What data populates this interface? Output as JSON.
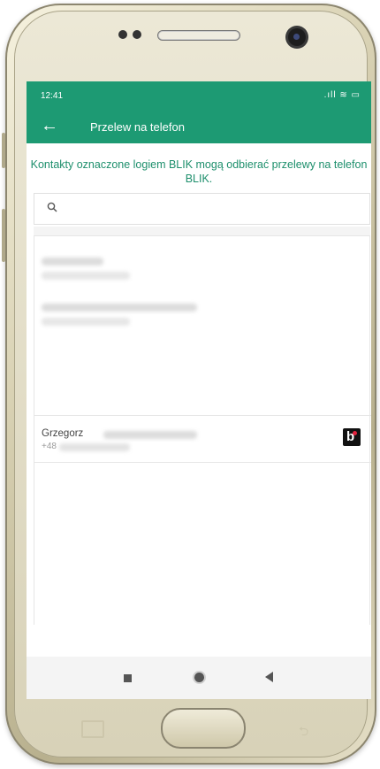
{
  "status_bar": {
    "time": "12:41",
    "icons": ".ıll ≋ ▭"
  },
  "app_bar": {
    "back_icon": "←",
    "title": "Przelew na telefon"
  },
  "info": {
    "text": "Kontakty oznaczone logiem BLIK mogą odbierać przelewy na telefon BLIK."
  },
  "search": {
    "placeholder": "",
    "value": ""
  },
  "contacts": [
    {
      "name": "Grzegorz",
      "phone": "+48",
      "blik": true,
      "blik_letter": "b"
    }
  ],
  "colors": {
    "accent": "#1d9a73",
    "info_text": "#1d8f6c",
    "blik_dot": "#e4213d"
  },
  "icons": {
    "back": "arrow-left-icon",
    "search": "search-icon",
    "blik": "blik-logo-icon"
  }
}
